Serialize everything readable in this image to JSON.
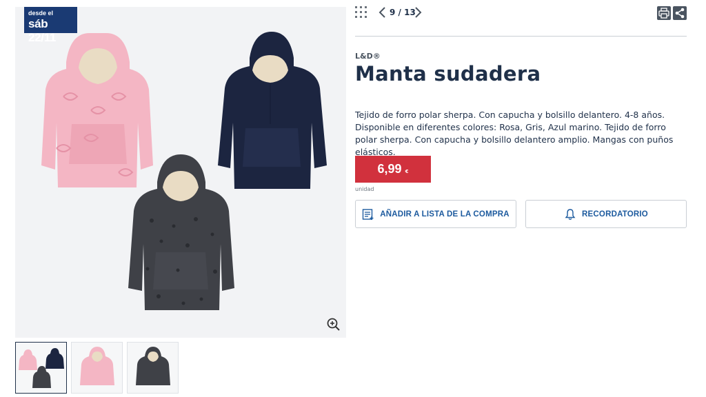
{
  "badge": {
    "line1": "desde el",
    "line2": "sáb 22/11"
  },
  "nav": {
    "counter": "9 / 13"
  },
  "product": {
    "brand": "L&D®",
    "title": "Manta sudadera",
    "description": "Tejido de forro polar sherpa. Con capucha y bolsillo delantero. 4-8 años. Disponible en diferentes colores: Rosa, Gris, Azul marino. Tejido de forro polar sherpa. Con capucha y bolsillo delantero amplio. Mangas con puños elásticos.",
    "price": "6,99",
    "currency": "€",
    "unit": "unidad"
  },
  "actions": {
    "add_to_list": "AÑADIR A LISTA DE LA COMPRA",
    "reminder": "RECORDATORIO"
  },
  "colors": {
    "pink": "#f4b6c4",
    "navy": "#1c2540",
    "grey": "#3f4147",
    "sherpa": "#e9dcc4",
    "price_red": "#d1313d",
    "badge_blue": "#1a3a73",
    "action_blue": "#1c5a9e"
  },
  "icons": {
    "grid": "grid-icon",
    "prev": "chevron-left-icon",
    "next": "chevron-right-icon",
    "print": "print-icon",
    "share": "share-icon",
    "zoom": "zoom-in-icon",
    "list": "list-add-icon",
    "bell": "bell-icon"
  }
}
